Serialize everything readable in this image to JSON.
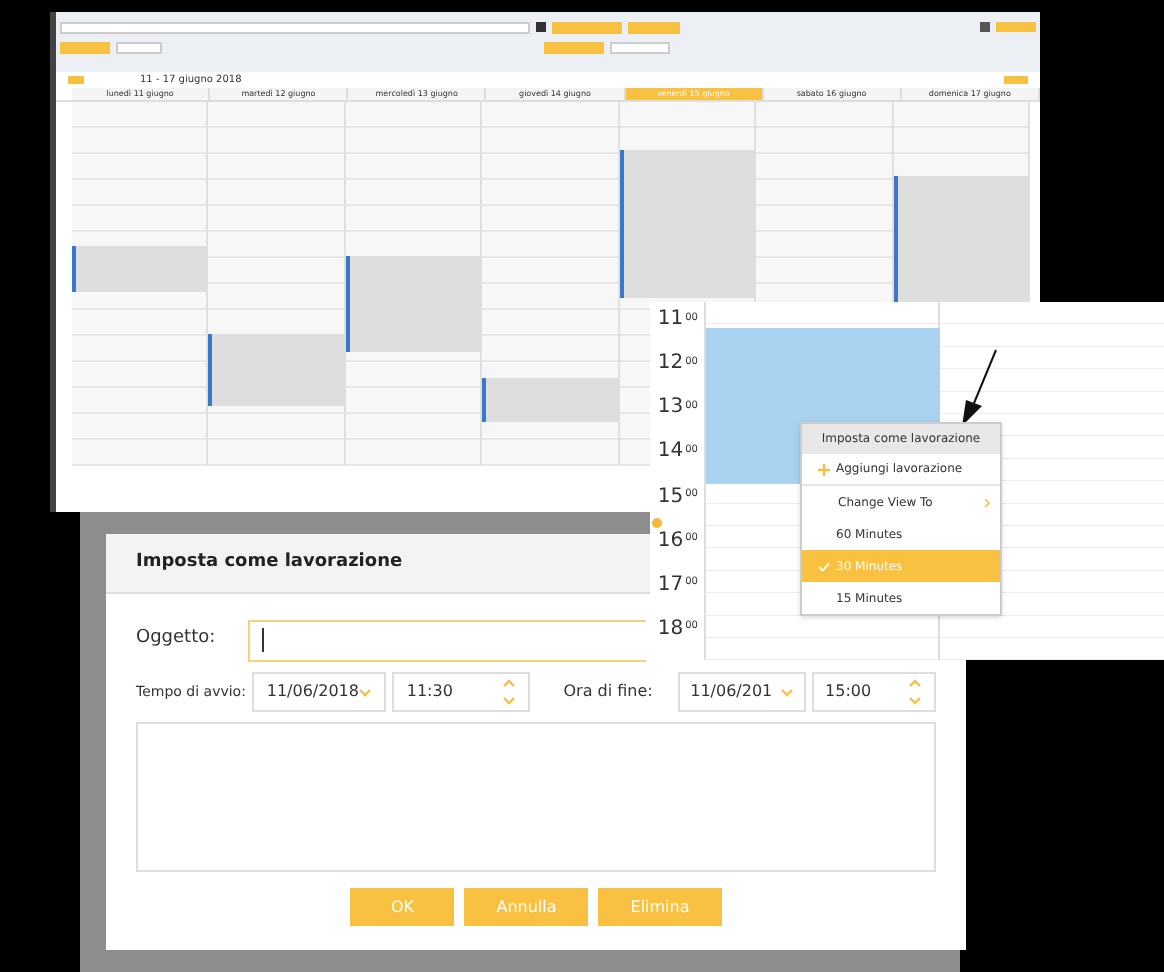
{
  "calendar": {
    "range": "11 - 17 giugno 2018",
    "days": [
      {
        "label": "lunedì 11 giugno",
        "selected": false
      },
      {
        "label": "martedì 12 giugno",
        "selected": false
      },
      {
        "label": "mercoledì 13 giugno",
        "selected": false
      },
      {
        "label": "giovedì 14 giugno",
        "selected": false
      },
      {
        "label": "venerdì 15 giugno",
        "selected": true
      },
      {
        "label": "sabato 16 giugno",
        "selected": false
      },
      {
        "label": "domenica 17 giugno",
        "selected": false
      }
    ]
  },
  "zoomed_calendar": {
    "hours": [
      {
        "hour": "11",
        "minutes": "00"
      },
      {
        "hour": "12",
        "minutes": "00"
      },
      {
        "hour": "13",
        "minutes": "00"
      },
      {
        "hour": "14",
        "minutes": "00"
      },
      {
        "hour": "15",
        "minutes": "00"
      },
      {
        "hour": "16",
        "minutes": "00"
      },
      {
        "hour": "17",
        "minutes": "00"
      },
      {
        "hour": "18",
        "minutes": "00"
      }
    ],
    "context_menu": {
      "title": "Imposta come lavorazione",
      "items": [
        {
          "kind": "action",
          "label": "Aggiungi lavorazione"
        },
        {
          "kind": "submenu",
          "label": "Change View To"
        },
        {
          "kind": "option",
          "label": "60 Minutes",
          "selected": false
        },
        {
          "kind": "option",
          "label": "30 Minutes",
          "selected": true
        },
        {
          "kind": "option",
          "label": "15 Minutes",
          "selected": false
        }
      ]
    }
  },
  "dialog": {
    "title": "Imposta come lavorazione",
    "subject_label": "Oggetto:",
    "start_label": "Tempo di avvio:",
    "start_date": "11/06/2018",
    "start_time": "11:30",
    "end_label": "Ora di fine:",
    "end_date": "11/06/201",
    "end_time": "15:00",
    "buttons": [
      "OK",
      "Annulla",
      "Elimina"
    ]
  }
}
